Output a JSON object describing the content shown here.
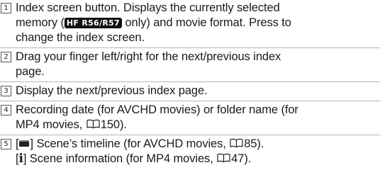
{
  "items": [
    {
      "number": "1",
      "line1": "Index screen button. Displays the currently selected",
      "line2_pre": "memory (",
      "badge": "HF R56/R57",
      "line2_post": " only) and movie format. Press to",
      "line3": "change the index screen."
    },
    {
      "number": "2",
      "line1": "Drag your finger left/right for the next/previous index",
      "line2": "page."
    },
    {
      "number": "3",
      "line1": "Display the next/previous index page."
    },
    {
      "number": "4",
      "line1": "Recording date (for AVCHD movies) or folder name (for",
      "line2_pre": "MP4 movies, ",
      "line2_ref": "150",
      "line2_post": ")."
    },
    {
      "number": "5",
      "line1_pre": "] Scene’s timeline (for AVCHD movies, ",
      "line1_ref": "85",
      "line1_post": ").",
      "line2_pre": "] Scene information (for MP4 movies, ",
      "line2_ref": "47",
      "line2_post": ").",
      "icon_timeline": "timeline-icon",
      "icon_info_glyph": "i"
    }
  ],
  "icons": {
    "book_reference": "book-reference-icon"
  }
}
